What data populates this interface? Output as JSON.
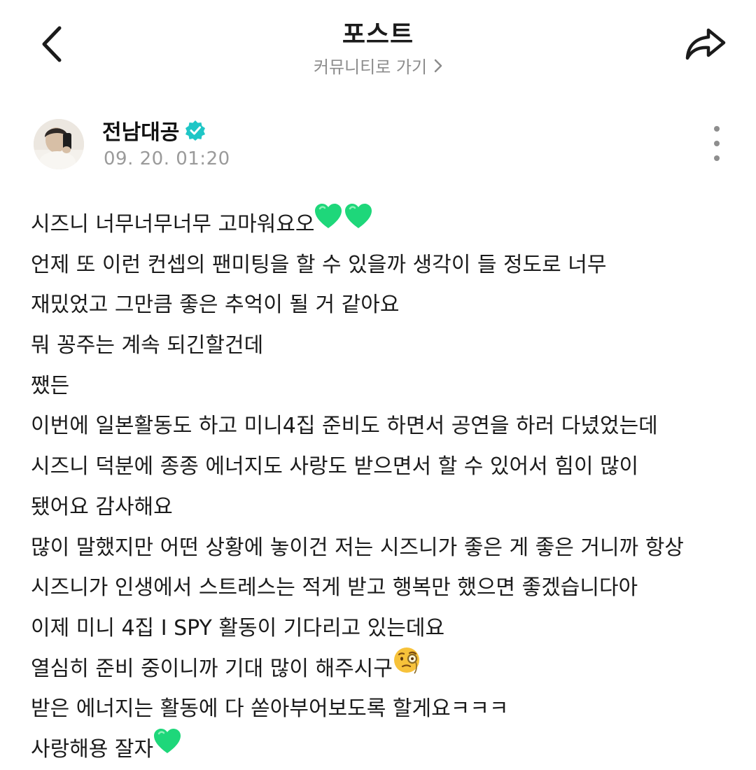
{
  "header": {
    "title": "포스트",
    "community_link": "커뮤니티로 가기",
    "icons": {
      "back": "chevron-left-icon",
      "share": "share-arrow-icon",
      "community_chevron": "chevron-right-icon"
    }
  },
  "post": {
    "author": "전남대공",
    "verified": true,
    "timestamp": "09. 20. 01:20",
    "more_icon": "more-vertical-icon",
    "lines": [
      "시즈니 너무너무너무 고마워요오",
      "언제 또 이런 컨셉의 팬미팅을 할 수 있을까 생각이 들 정도로 너무",
      "재밌었고 그만큼 좋은 추억이 될 거 같아요",
      "뭐 꽁주는 계속 되긴할건데",
      "쨌든",
      "이번에 일본활동도 하고 미니4집 준비도 하면서 공연을 하러 다녔었는데",
      "시즈니 덕분에 종종 에너지도 사랑도 받으면서 할 수 있어서 힘이 많이",
      "됐어요 감사해요",
      "많이 말했지만 어떤 상황에 놓이건 저는 시즈니가 좋은 게 좋은 거니까 항상",
      "시즈니가 인생에서 스트레스는 적게 받고 행복만 했으면 좋겠습니다아",
      "이제 미니 4집 I SPY 활동이 기다리고 있는데요",
      "열심히 준비 중이니까 기대 많이 해주시구",
      "받은 에너지는 활동에 다 쏟아부어보도록 할게요ㅋㅋㅋ",
      "사랑해용 잘자"
    ],
    "emojis": {
      "heart": "green-heart-emoji",
      "monocle": "face-with-monocle-emoji"
    }
  },
  "colors": {
    "verified": "#1fc6c6",
    "heart": "#1ed77a",
    "muted_text": "#8c8c8c"
  }
}
